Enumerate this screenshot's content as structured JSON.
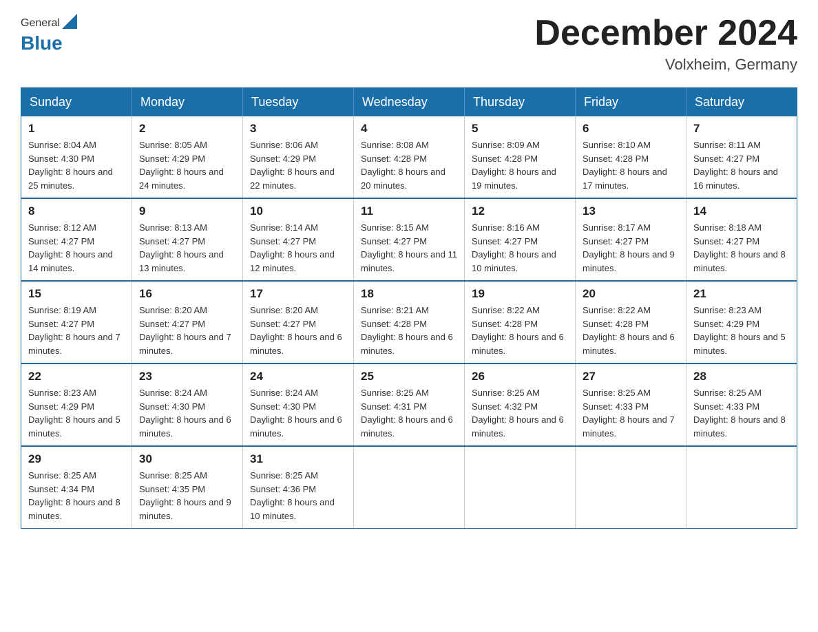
{
  "header": {
    "logo_general": "General",
    "logo_blue": "Blue",
    "month_title": "December 2024",
    "location": "Volxheim, Germany"
  },
  "weekdays": [
    "Sunday",
    "Monday",
    "Tuesday",
    "Wednesday",
    "Thursday",
    "Friday",
    "Saturday"
  ],
  "weeks": [
    [
      {
        "day": "1",
        "sunrise": "8:04 AM",
        "sunset": "4:30 PM",
        "daylight": "8 hours and 25 minutes."
      },
      {
        "day": "2",
        "sunrise": "8:05 AM",
        "sunset": "4:29 PM",
        "daylight": "8 hours and 24 minutes."
      },
      {
        "day": "3",
        "sunrise": "8:06 AM",
        "sunset": "4:29 PM",
        "daylight": "8 hours and 22 minutes."
      },
      {
        "day": "4",
        "sunrise": "8:08 AM",
        "sunset": "4:28 PM",
        "daylight": "8 hours and 20 minutes."
      },
      {
        "day": "5",
        "sunrise": "8:09 AM",
        "sunset": "4:28 PM",
        "daylight": "8 hours and 19 minutes."
      },
      {
        "day": "6",
        "sunrise": "8:10 AM",
        "sunset": "4:28 PM",
        "daylight": "8 hours and 17 minutes."
      },
      {
        "day": "7",
        "sunrise": "8:11 AM",
        "sunset": "4:27 PM",
        "daylight": "8 hours and 16 minutes."
      }
    ],
    [
      {
        "day": "8",
        "sunrise": "8:12 AM",
        "sunset": "4:27 PM",
        "daylight": "8 hours and 14 minutes."
      },
      {
        "day": "9",
        "sunrise": "8:13 AM",
        "sunset": "4:27 PM",
        "daylight": "8 hours and 13 minutes."
      },
      {
        "day": "10",
        "sunrise": "8:14 AM",
        "sunset": "4:27 PM",
        "daylight": "8 hours and 12 minutes."
      },
      {
        "day": "11",
        "sunrise": "8:15 AM",
        "sunset": "4:27 PM",
        "daylight": "8 hours and 11 minutes."
      },
      {
        "day": "12",
        "sunrise": "8:16 AM",
        "sunset": "4:27 PM",
        "daylight": "8 hours and 10 minutes."
      },
      {
        "day": "13",
        "sunrise": "8:17 AM",
        "sunset": "4:27 PM",
        "daylight": "8 hours and 9 minutes."
      },
      {
        "day": "14",
        "sunrise": "8:18 AM",
        "sunset": "4:27 PM",
        "daylight": "8 hours and 8 minutes."
      }
    ],
    [
      {
        "day": "15",
        "sunrise": "8:19 AM",
        "sunset": "4:27 PM",
        "daylight": "8 hours and 7 minutes."
      },
      {
        "day": "16",
        "sunrise": "8:20 AM",
        "sunset": "4:27 PM",
        "daylight": "8 hours and 7 minutes."
      },
      {
        "day": "17",
        "sunrise": "8:20 AM",
        "sunset": "4:27 PM",
        "daylight": "8 hours and 6 minutes."
      },
      {
        "day": "18",
        "sunrise": "8:21 AM",
        "sunset": "4:28 PM",
        "daylight": "8 hours and 6 minutes."
      },
      {
        "day": "19",
        "sunrise": "8:22 AM",
        "sunset": "4:28 PM",
        "daylight": "8 hours and 6 minutes."
      },
      {
        "day": "20",
        "sunrise": "8:22 AM",
        "sunset": "4:28 PM",
        "daylight": "8 hours and 6 minutes."
      },
      {
        "day": "21",
        "sunrise": "8:23 AM",
        "sunset": "4:29 PM",
        "daylight": "8 hours and 5 minutes."
      }
    ],
    [
      {
        "day": "22",
        "sunrise": "8:23 AM",
        "sunset": "4:29 PM",
        "daylight": "8 hours and 5 minutes."
      },
      {
        "day": "23",
        "sunrise": "8:24 AM",
        "sunset": "4:30 PM",
        "daylight": "8 hours and 6 minutes."
      },
      {
        "day": "24",
        "sunrise": "8:24 AM",
        "sunset": "4:30 PM",
        "daylight": "8 hours and 6 minutes."
      },
      {
        "day": "25",
        "sunrise": "8:25 AM",
        "sunset": "4:31 PM",
        "daylight": "8 hours and 6 minutes."
      },
      {
        "day": "26",
        "sunrise": "8:25 AM",
        "sunset": "4:32 PM",
        "daylight": "8 hours and 6 minutes."
      },
      {
        "day": "27",
        "sunrise": "8:25 AM",
        "sunset": "4:33 PM",
        "daylight": "8 hours and 7 minutes."
      },
      {
        "day": "28",
        "sunrise": "8:25 AM",
        "sunset": "4:33 PM",
        "daylight": "8 hours and 8 minutes."
      }
    ],
    [
      {
        "day": "29",
        "sunrise": "8:25 AM",
        "sunset": "4:34 PM",
        "daylight": "8 hours and 8 minutes."
      },
      {
        "day": "30",
        "sunrise": "8:25 AM",
        "sunset": "4:35 PM",
        "daylight": "8 hours and 9 minutes."
      },
      {
        "day": "31",
        "sunrise": "8:25 AM",
        "sunset": "4:36 PM",
        "daylight": "8 hours and 10 minutes."
      },
      null,
      null,
      null,
      null
    ]
  ],
  "labels": {
    "sunrise": "Sunrise:",
    "sunset": "Sunset:",
    "daylight": "Daylight:"
  }
}
